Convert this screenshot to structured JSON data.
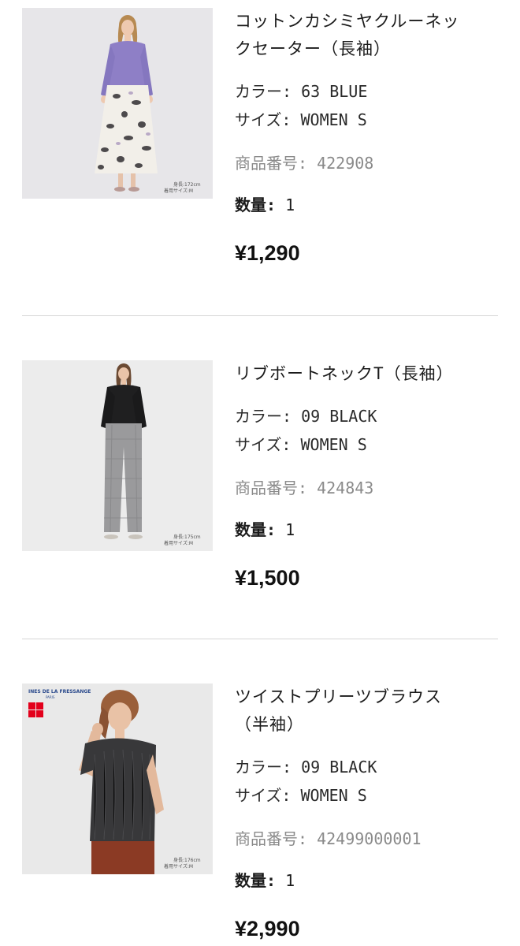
{
  "cart": {
    "items": [
      {
        "name_line1": "コットンカシミヤクルーネッ",
        "name_line2": "クセーター（長袖）",
        "color": "カラー: 63 BLUE",
        "size": "サイズ: WOMEN S",
        "product_no": "商品番号: 422908",
        "qty_label": "数量:",
        "qty_value": "1",
        "price": "¥1,290",
        "photo_caption_1": "身長:172cm",
        "photo_caption_2": "着用サイズ:M"
      },
      {
        "name_line1": "リブボートネックT（長袖）",
        "color": "カラー: 09 BLACK",
        "size": "サイズ: WOMEN S",
        "product_no": "商品番号: 424843",
        "qty_label": "数量:",
        "qty_value": "1",
        "price": "¥1,500",
        "photo_caption_1": "身長:175cm",
        "photo_caption_2": "着用サイズ:M"
      },
      {
        "name_line1": "ツイストプリーツブラウス",
        "name_line2": "（半袖）",
        "color": "カラー: 09 BLACK",
        "size": "サイズ: WOMEN S",
        "product_no": "商品番号: 42499000001",
        "qty_label": "数量:",
        "qty_value": "1",
        "price": "¥2,990",
        "photo_caption_1": "身長:176cm",
        "photo_caption_2": "着用サイズ:M",
        "collab_label": "INES DE LA FRESSANGE",
        "collab_sub": "PARIS"
      }
    ]
  }
}
